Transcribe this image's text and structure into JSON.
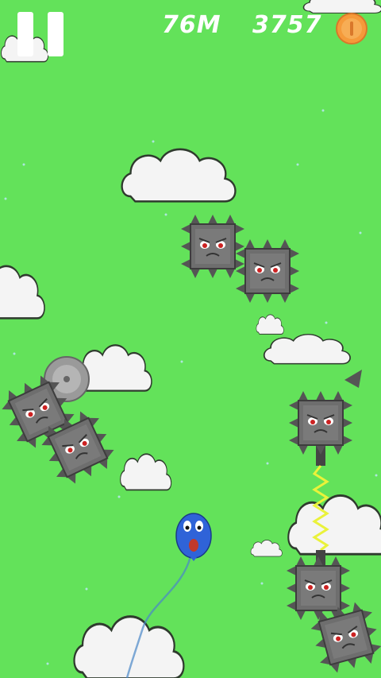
{
  "hud": {
    "distance": "76M",
    "coins": "3757",
    "pause_icon": "pause-icon",
    "coin_icon": "coin-icon"
  },
  "colors": {
    "sky": "#63e25a",
    "cloud": "#f4f4f4",
    "cloud_outline": "#2f3a2e",
    "spike_block": "#6e6e6e",
    "balloon": "#2f63d8",
    "spring": "#eaf23a",
    "coin": "#f59a3a"
  }
}
